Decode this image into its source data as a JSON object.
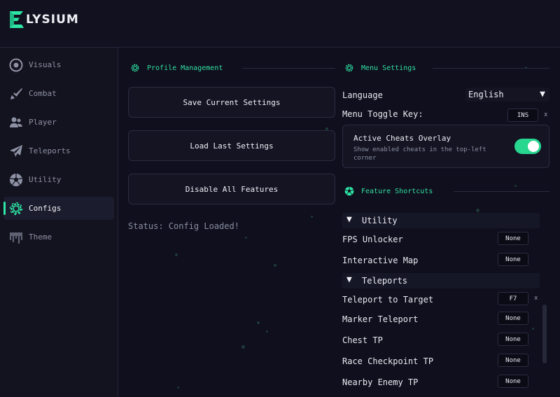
{
  "app": {
    "logo_letter": "E",
    "logo_text": "LYSIUM"
  },
  "sidebar": {
    "items": [
      {
        "label": "Visuals",
        "icon": "eye-icon"
      },
      {
        "label": "Combat",
        "icon": "sword-icon"
      },
      {
        "label": "Player",
        "icon": "users-icon"
      },
      {
        "label": "Teleports",
        "icon": "paper-plane-icon"
      },
      {
        "label": "Utility",
        "icon": "soccer-ball-icon"
      },
      {
        "label": "Configs",
        "icon": "gear-icon",
        "active": true
      },
      {
        "label": "Theme",
        "icon": "paint-drip-icon"
      }
    ]
  },
  "profile": {
    "title": "Profile Management",
    "save_label": "Save Current Settings",
    "load_label": "Load Last Settings",
    "disable_label": "Disable All Features",
    "status": "Status: Config Loaded!"
  },
  "menu_settings": {
    "title": "Menu Settings",
    "language_label": "Language",
    "language_value": "English",
    "toggle_key_label": "Menu Toggle Key:",
    "toggle_key_value": "INS",
    "clear": "x",
    "overlay_title": "Active Cheats Overlay",
    "overlay_desc": "Show enabled cheats in the top-left corner",
    "overlay_on": true
  },
  "shortcuts": {
    "title": "Feature Shortcuts",
    "groups": [
      {
        "name": "Utility",
        "items": [
          {
            "label": "FPS Unlocker",
            "key": "None"
          },
          {
            "label": "Interactive Map",
            "key": "None"
          }
        ]
      },
      {
        "name": "Teleports",
        "items": [
          {
            "label": "Teleport to Target",
            "key": "F7",
            "clear": "x"
          },
          {
            "label": "Marker Teleport",
            "key": "None"
          },
          {
            "label": "Chest TP",
            "key": "None"
          },
          {
            "label": "Race Checkpoint TP",
            "key": "None"
          },
          {
            "label": "Nearby Enemy TP",
            "key": "None"
          }
        ]
      }
    ]
  },
  "colors": {
    "accent": "#2ee6a6",
    "background": "#0f0f1d",
    "toggle_on": "#27d68f"
  }
}
